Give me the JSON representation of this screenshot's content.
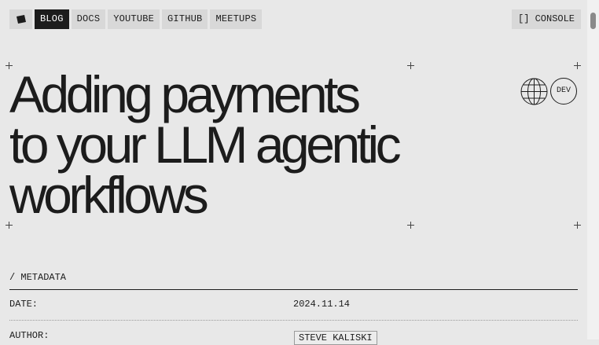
{
  "nav": {
    "logo_icon": "book-icon",
    "items": [
      {
        "label": "BLOG",
        "active": true
      },
      {
        "label": "DOCS"
      },
      {
        "label": "YOUTUBE"
      },
      {
        "label": "GITHUB"
      },
      {
        "label": "MEETUPS"
      }
    ],
    "console_label": "[] CONSOLE"
  },
  "header": {
    "title_lines": [
      "Adding payments",
      "to your LLM agentic",
      "workflows"
    ],
    "language_icon": "globe-icon",
    "dev_label": "DEV"
  },
  "metadata": {
    "heading": "/ METADATA",
    "date_label": "DATE:",
    "date_value": "2024.11.14",
    "author_label": "AUTHOR:",
    "author_value": "STEVE KALISKI"
  },
  "colors": {
    "background": "#e8e8e8",
    "text": "#1c1c1c",
    "nav_bg": "#d8d8d8",
    "nav_active_bg": "#1c1c1c"
  }
}
